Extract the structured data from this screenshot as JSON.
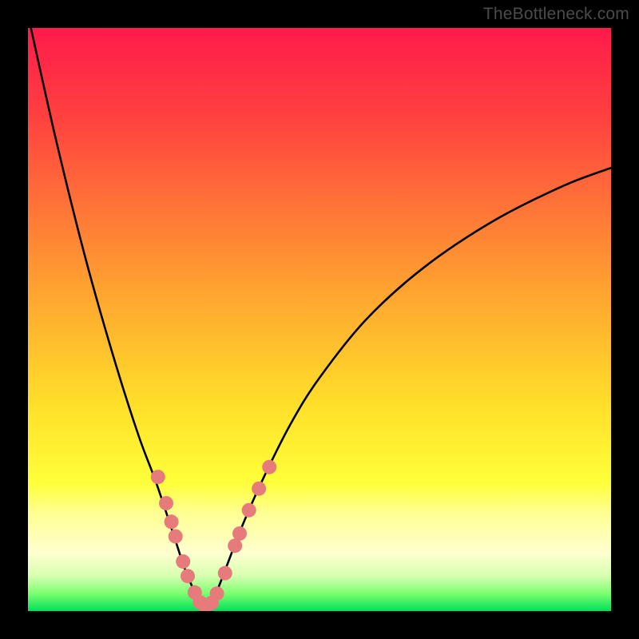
{
  "watermark": "TheBottleneck.com",
  "chart_data": {
    "type": "line",
    "title": "",
    "xlabel": "",
    "ylabel": "",
    "xlim": [
      0,
      100
    ],
    "ylim": [
      0,
      100
    ],
    "gradient_stops": [
      {
        "pct": 0,
        "color": "#ff1b4b"
      },
      {
        "pct": 15,
        "color": "#ff4040"
      },
      {
        "pct": 45,
        "color": "#ffa330"
      },
      {
        "pct": 65,
        "color": "#ffe02a"
      },
      {
        "pct": 78,
        "color": "#ffff3a"
      },
      {
        "pct": 83,
        "color": "#ffff90"
      },
      {
        "pct": 90,
        "color": "#ffffd0"
      },
      {
        "pct": 94,
        "color": "#d6ffb0"
      },
      {
        "pct": 97,
        "color": "#7cff70"
      },
      {
        "pct": 100,
        "color": "#00e05a"
      }
    ],
    "series": [
      {
        "name": "bottleneck-curve",
        "x": [
          0.5,
          5,
          10,
          15,
          19,
          22,
          25,
          27,
          29,
          30.5,
          32,
          34,
          36.5,
          40,
          45,
          50,
          58,
          68,
          80,
          92,
          100
        ],
        "y": [
          100,
          80,
          60,
          42.5,
          30,
          22,
          13,
          7,
          2.5,
          0.5,
          2.5,
          7.5,
          14,
          22,
          32,
          40,
          50,
          59,
          67,
          73,
          76
        ]
      }
    ],
    "markers": {
      "name": "highlighted-points",
      "color": "#e77b7b",
      "radius": 9,
      "points": [
        {
          "x": 22.3,
          "y": 23.0
        },
        {
          "x": 23.7,
          "y": 18.5
        },
        {
          "x": 24.6,
          "y": 15.3
        },
        {
          "x": 25.3,
          "y": 12.8
        },
        {
          "x": 26.6,
          "y": 8.5
        },
        {
          "x": 27.4,
          "y": 6.0
        },
        {
          "x": 28.6,
          "y": 3.2
        },
        {
          "x": 29.5,
          "y": 1.5
        },
        {
          "x": 30.5,
          "y": 0.8
        },
        {
          "x": 31.5,
          "y": 1.4
        },
        {
          "x": 32.4,
          "y": 3.0
        },
        {
          "x": 33.8,
          "y": 6.5
        },
        {
          "x": 35.5,
          "y": 11.2
        },
        {
          "x": 36.3,
          "y": 13.3
        },
        {
          "x": 37.9,
          "y": 17.3
        },
        {
          "x": 39.6,
          "y": 21.0
        },
        {
          "x": 41.4,
          "y": 24.7
        }
      ]
    }
  }
}
